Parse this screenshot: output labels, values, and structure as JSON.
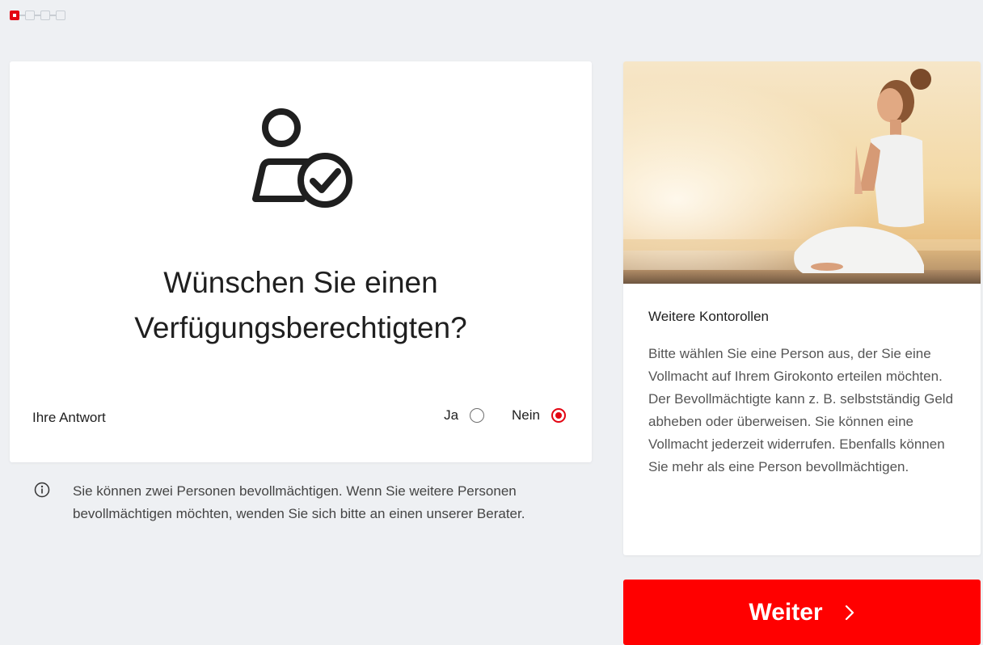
{
  "progress": {
    "current_step": 1,
    "total_steps": 4
  },
  "main": {
    "question_line1": "Wünschen Sie einen",
    "question_line2": "Verfügungsberechtigten?",
    "answer_label": "Ihre Antwort",
    "options": [
      {
        "label": "Ja",
        "selected": false
      },
      {
        "label": "Nein",
        "selected": true
      }
    ]
  },
  "info": {
    "icon": "info-icon",
    "text": "Sie können zwei Personen bevollmächtigen. Wenn Sie weitere Personen bevollmächtigen möchten, wenden Sie sich bitte an einen unserer Berater."
  },
  "side": {
    "title": "Weitere Kontorollen",
    "text": "Bitte wählen Sie eine Person aus, der Sie eine Vollmacht auf Ihrem Girokonto erteilen möchten. Der Bevollmächtigte kann z. B. selbstständig Geld abheben oder überweisen. Sie können eine Vollmacht jederzeit widerrufen. Ebenfalls können Sie mehr als eine Person bevollmächtigen."
  },
  "cta": {
    "label": "Weiter",
    "icon": "chevron-right-icon"
  },
  "colors": {
    "accent": "#e30613",
    "cta_background": "#ff0000",
    "page_background": "#eef0f3"
  }
}
